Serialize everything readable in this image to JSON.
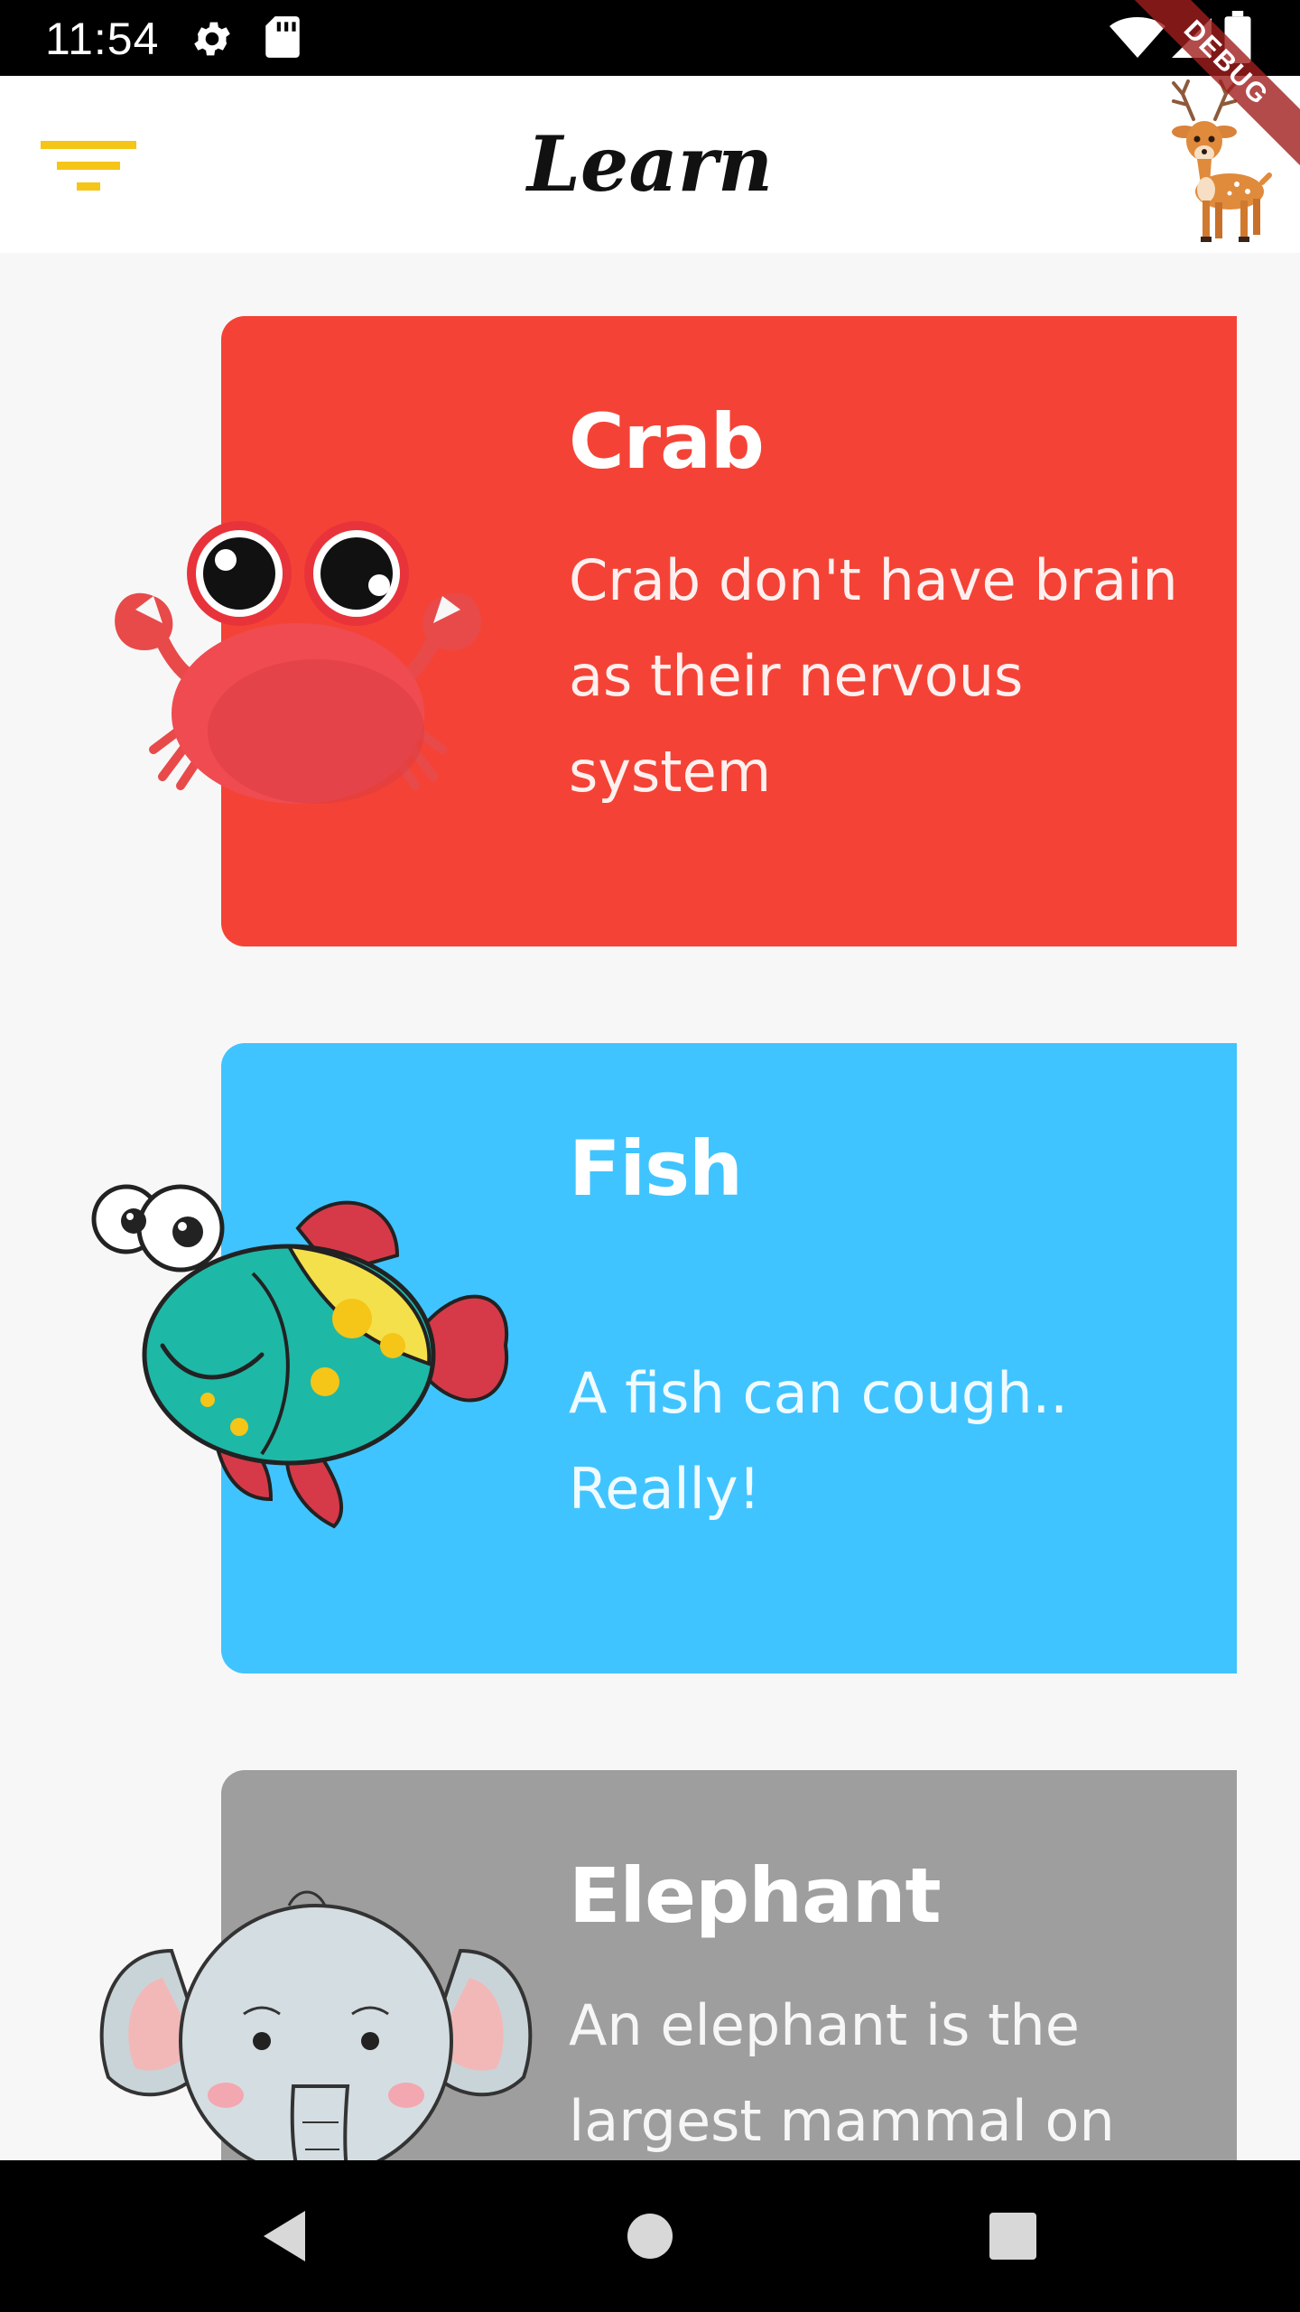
{
  "status_bar": {
    "time": "11:54",
    "icons": [
      "gear-icon",
      "sd-card-icon",
      "wifi-icon",
      "signal-icon",
      "battery-icon"
    ]
  },
  "debug_banner": "DEBUG",
  "app_bar": {
    "title": "Learn",
    "menu_icon": "filter-menu-icon",
    "menu_color": "#f5c518",
    "avatar": "deer-icon"
  },
  "cards": [
    {
      "name": "Crab",
      "fact": "Crab don't have brain as their nervous system",
      "color": "#f44336",
      "icon": "crab-icon"
    },
    {
      "name": "Fish",
      "fact": "A fish can cough.. Really!",
      "color": "#40c4ff",
      "icon": "fish-icon"
    },
    {
      "name": "Elephant",
      "fact": "An elephant is the largest mammal on",
      "color": "#9e9e9e",
      "icon": "elephant-icon"
    }
  ],
  "nav_bar": {
    "buttons": [
      "back-icon",
      "home-icon",
      "recents-icon"
    ]
  }
}
